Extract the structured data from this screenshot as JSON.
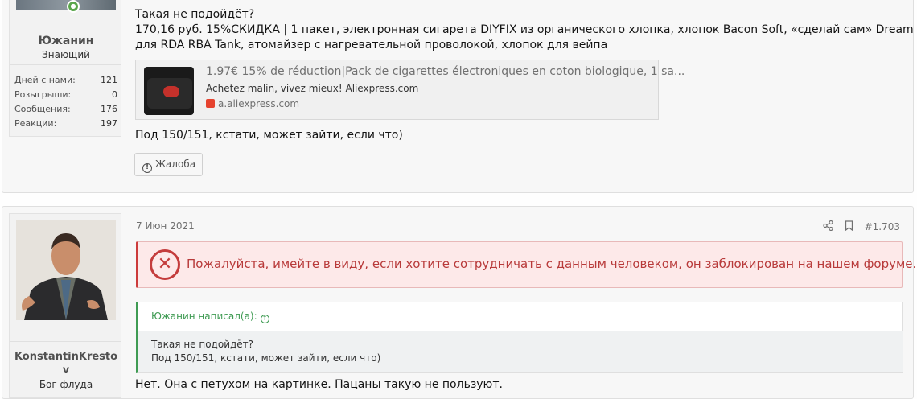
{
  "post1": {
    "user": {
      "name": "Южанин",
      "title": "Знающий"
    },
    "stats": [
      {
        "label": "Дней с нами:",
        "value": "121"
      },
      {
        "label": "Розыгрыши:",
        "value": "0"
      },
      {
        "label": "Сообщения:",
        "value": "176"
      },
      {
        "label": "Реакции:",
        "value": "197"
      }
    ],
    "lines": [
      "Такая не подойдёт?",
      "170,16 руб. 15%СКИДКА | 1 пакет, электронная сигарета DIYFIX из органического хлопка, хлопок Bacon Soft, «сделай сам» Dream Cotton",
      "для RDA RBA Tank, атомайзер с нагревательной проволокой, хлопок для вейпа"
    ],
    "unfurl": {
      "title": "1.97€ 15% de réduction|Pack de cigarettes électroniques en coton biologique, 1 sa...",
      "description": "Achetez malin, vivez mieux! Aliexpress.com",
      "domain": "a.aliexpress.com"
    },
    "after_text": "Под 150/151, кстати, может зайти, если что)",
    "report_label": "Жалоба"
  },
  "post2": {
    "user": {
      "name_line1": "KonstantinKresto",
      "name_line2": "v",
      "title": "Бог флуда"
    },
    "date": "7 Июн 2021",
    "post_number": "#1.703",
    "warning": "Пожалуйста, имейте в виду, если хотите сотрудничать с данным человеком, он заблокирован на нашем форуме.",
    "quote": {
      "author_line": "Южанин написал(а):",
      "lines": [
        "Такая не подойдёт?",
        "Под 150/151, кстати, может зайти, если что)"
      ]
    },
    "message": "Нет. Она с петухом на картинке. Пацаны такую не пользуют."
  },
  "colors": {
    "accent_green": "#3f9b53",
    "warning_red": "#c43c3c",
    "background": "#f7f7f7"
  }
}
